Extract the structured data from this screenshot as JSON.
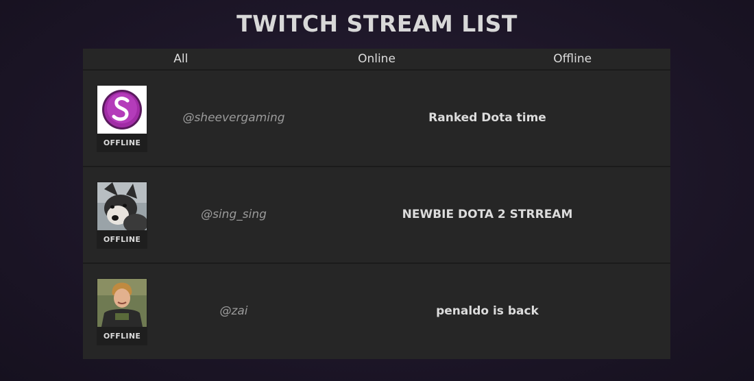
{
  "header": {
    "title": "TWITCH STREAM LIST"
  },
  "tabs": [
    {
      "label": "All"
    },
    {
      "label": "Online"
    },
    {
      "label": "Offline"
    }
  ],
  "streams": [
    {
      "handle": "@sheevergaming",
      "status": "OFFLINE",
      "title": "Ranked Dota time",
      "avatar": "purple-s-logo"
    },
    {
      "handle": "@sing_sing",
      "status": "OFFLINE",
      "title": "NEWBIE DOTA 2 STRREAM",
      "avatar": "husky-dog-photo"
    },
    {
      "handle": "@zai",
      "status": "OFFLINE",
      "title": "penaldo is back",
      "avatar": "person-photo"
    }
  ]
}
